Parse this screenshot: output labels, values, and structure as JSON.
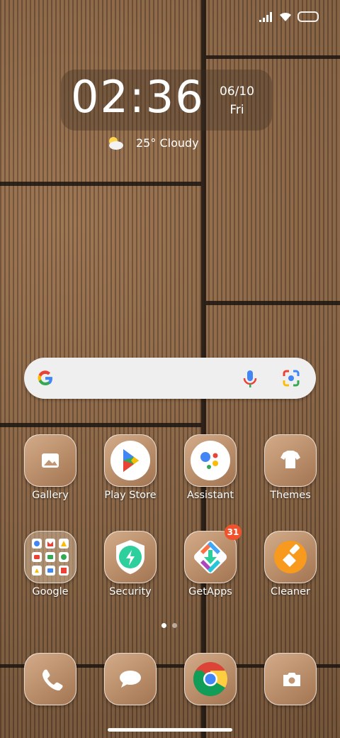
{
  "clock": {
    "time": "02:36",
    "date": "06/10",
    "day": "Fri"
  },
  "weather": {
    "text": "25° Cloudy",
    "icon": "partly-cloudy-icon"
  },
  "search": {
    "logo": "google-g-icon",
    "mic": "mic-icon",
    "lens": "lens-icon"
  },
  "apps_row1": [
    {
      "label": "Gallery",
      "icon": "gallery-icon"
    },
    {
      "label": "Play Store",
      "icon": "play-store-icon"
    },
    {
      "label": "Assistant",
      "icon": "assistant-icon"
    },
    {
      "label": "Themes",
      "icon": "themes-icon"
    }
  ],
  "apps_row2": [
    {
      "label": "Google",
      "icon": "google-folder-icon"
    },
    {
      "label": "Security",
      "icon": "security-icon"
    },
    {
      "label": "GetApps",
      "icon": "getapps-icon",
      "badge": "31"
    },
    {
      "label": "Cleaner",
      "icon": "cleaner-icon"
    }
  ],
  "dock": [
    {
      "icon": "phone-icon"
    },
    {
      "icon": "messages-icon"
    },
    {
      "icon": "chrome-icon"
    },
    {
      "icon": "camera-icon"
    }
  ],
  "colors": {
    "badge": "#f1522c",
    "tile": "#c19674",
    "wallpaper": "#7a5a3d"
  }
}
